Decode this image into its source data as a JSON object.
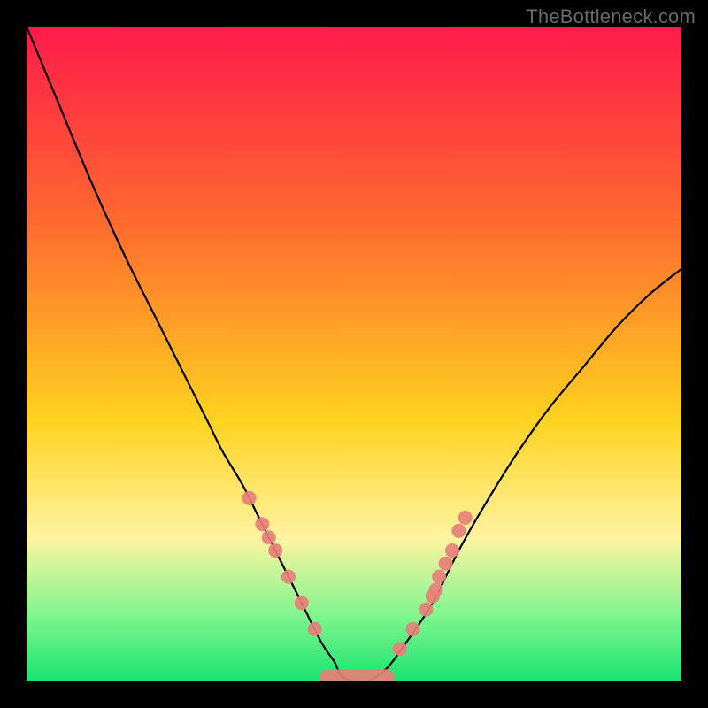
{
  "watermark": "TheBottleneck.com",
  "chart_data": {
    "type": "line",
    "title": "",
    "xlabel": "",
    "ylabel": "",
    "xlim": [
      0,
      100
    ],
    "ylim": [
      0,
      100
    ],
    "legend": false,
    "grid": false,
    "background_gradient": [
      "#ff1a4b",
      "#ff6a2f",
      "#ffd21f",
      "#fff3a0",
      "#7ff58e",
      "#19e36f"
    ],
    "series": [
      {
        "name": "bottleneck-curve",
        "x": [
          0,
          5,
          10,
          15,
          20,
          25,
          28,
          30,
          33,
          35,
          37,
          40,
          42,
          45,
          47,
          48,
          50,
          52,
          55,
          58,
          62,
          66,
          70,
          75,
          80,
          85,
          90,
          95,
          100
        ],
        "y": [
          100,
          88,
          76,
          65,
          55,
          45,
          39,
          35,
          30,
          26,
          22,
          16,
          12,
          6,
          3,
          1,
          0,
          0,
          2,
          6,
          12,
          20,
          27,
          35,
          42,
          48,
          54,
          59,
          63
        ]
      }
    ],
    "markers": {
      "left_cluster": {
        "name": "left-data-points",
        "color": "#e77f79",
        "points": [
          {
            "x": 34,
            "y": 28
          },
          {
            "x": 36,
            "y": 24
          },
          {
            "x": 37,
            "y": 22
          },
          {
            "x": 38,
            "y": 20
          },
          {
            "x": 40,
            "y": 16
          },
          {
            "x": 42,
            "y": 12
          },
          {
            "x": 44,
            "y": 8
          }
        ]
      },
      "right_cluster": {
        "name": "right-data-points",
        "color": "#e77f79",
        "points": [
          {
            "x": 57,
            "y": 5
          },
          {
            "x": 59,
            "y": 8
          },
          {
            "x": 61,
            "y": 11
          },
          {
            "x": 62,
            "y": 13
          },
          {
            "x": 62.5,
            "y": 14
          },
          {
            "x": 63,
            "y": 16
          },
          {
            "x": 64,
            "y": 18
          },
          {
            "x": 65,
            "y": 20
          },
          {
            "x": 66,
            "y": 23
          },
          {
            "x": 67,
            "y": 25
          }
        ]
      },
      "bottom_band": {
        "name": "valley-data-points",
        "color": "#e77f79",
        "points": [
          {
            "x": 46,
            "y": 1
          },
          {
            "x": 47.5,
            "y": 0.5
          },
          {
            "x": 49,
            "y": 0.5
          },
          {
            "x": 50.5,
            "y": 0.5
          },
          {
            "x": 52,
            "y": 0.5
          },
          {
            "x": 53.5,
            "y": 0.5
          },
          {
            "x": 55,
            "y": 1
          }
        ]
      }
    }
  }
}
